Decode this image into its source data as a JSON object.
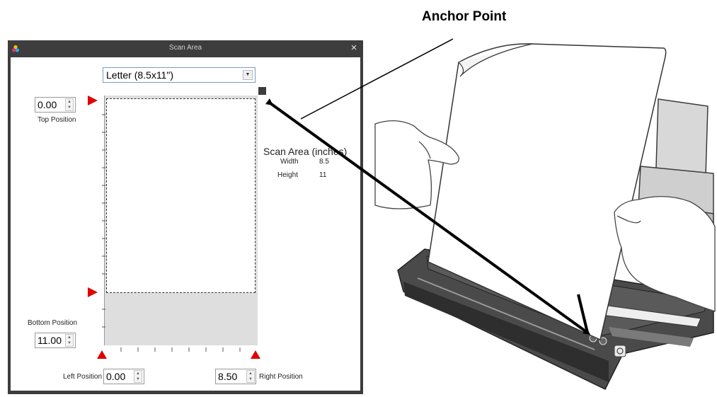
{
  "annotation": {
    "heading": "Anchor Point"
  },
  "dialog": {
    "title": "Scan Area",
    "close_glyph": "×",
    "app_icon": "color-dots-icon",
    "paper_size": "Letter (8.5x11\")",
    "dropdown_glyph": "▼",
    "spin_up_glyph": "▲",
    "spin_down_glyph": "▼",
    "top_position": {
      "label": "Top Position",
      "value": "0.00"
    },
    "bottom_position": {
      "label": "Bottom Position",
      "value": "11.00"
    },
    "left_position": {
      "label": "Left Position",
      "value": "0.00"
    },
    "right_position": {
      "label": "Right Position",
      "value": "8.50"
    },
    "scan_area": {
      "title": "Scan Area (inches)",
      "width_label": "Width",
      "width_value": "8.5",
      "height_label": "Height",
      "height_value": "11"
    }
  },
  "colors": {
    "marker": "#e00000",
    "window_frame": "#3d3d3d",
    "dropdown_border": "#7a9cc9"
  }
}
